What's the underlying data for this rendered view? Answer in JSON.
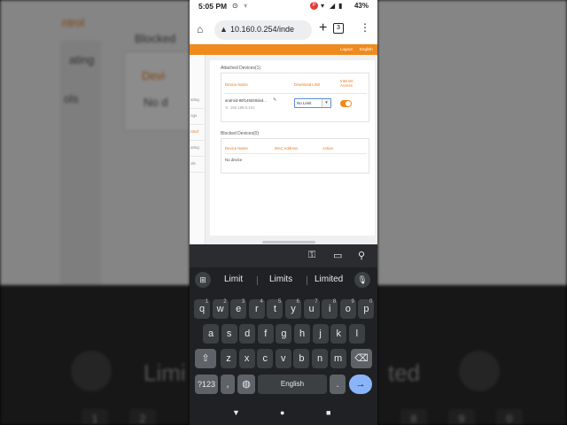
{
  "background": {
    "left_texts": [
      "ntrol",
      "ating",
      "ols",
      "Blocked",
      "Devi",
      "No d"
    ],
    "right_suggestion": "ted",
    "left_suggestion": "Limi",
    "left_keys": [
      "1",
      "2"
    ],
    "right_keys": [
      "8",
      "9",
      "0"
    ]
  },
  "status_bar": {
    "time": "5:05 PM",
    "battery": "43%",
    "notification_badge": "P"
  },
  "browser": {
    "url": "10.160.0.254/inde",
    "tab_count": "3"
  },
  "router_page": {
    "top_links": [
      "Logout",
      "English"
    ],
    "sidebar_items": [
      "ating",
      "ngs",
      "ntrol",
      "ating",
      "ols"
    ],
    "attached_title": "Attached Devices(1)",
    "attached_columns": [
      "Device Name",
      "Download Limit",
      "Internet Access"
    ],
    "attached_devices": [
      {
        "name": "android-89f149d48ded...",
        "ip": "192.168.0.101",
        "limit": "No Limit",
        "internet_access": true
      }
    ],
    "blocked_title": "Blocked Devices(0)",
    "blocked_columns": [
      "Device Name",
      "MAC Address",
      "Action"
    ],
    "blocked_empty": "No device"
  },
  "keyboard": {
    "suggestions": [
      "Limit",
      "Limits",
      "Limited"
    ],
    "row1": [
      {
        "k": "q",
        "s": "1"
      },
      {
        "k": "w",
        "s": "2"
      },
      {
        "k": "e",
        "s": "3"
      },
      {
        "k": "r",
        "s": "4"
      },
      {
        "k": "t",
        "s": "5"
      },
      {
        "k": "y",
        "s": "6"
      },
      {
        "k": "u",
        "s": "7"
      },
      {
        "k": "i",
        "s": "8"
      },
      {
        "k": "o",
        "s": "9"
      },
      {
        "k": "p",
        "s": "0"
      }
    ],
    "row2": [
      "a",
      "s",
      "d",
      "f",
      "g",
      "h",
      "j",
      "k",
      "l"
    ],
    "row3": [
      "z",
      "x",
      "c",
      "v",
      "b",
      "n",
      "m"
    ],
    "symbols_key": "?123",
    "comma_key": ",",
    "space_label": "English",
    "period_key": "."
  },
  "colors": {
    "accent": "#f08a1f",
    "keyboard_bg": "#202124",
    "key_bg": "#3c4043",
    "enter_key": "#8ab4f8"
  }
}
